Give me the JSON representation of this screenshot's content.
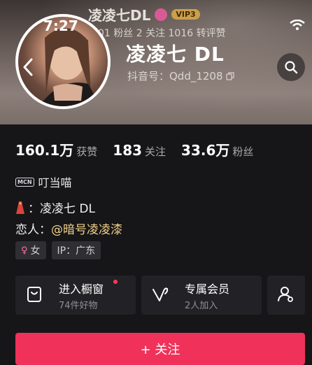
{
  "status_bar": {
    "time": "7:27",
    "wifi_icon": "wifi-icon"
  },
  "header_ghost": {
    "name": "凌凌七DL",
    "vip_label": "VIP3",
    "stats_text": "01 粉丝   2 关注   1016 转评赞"
  },
  "profile": {
    "display_name": "凌凌七 DL",
    "account_id": "抖音号：Qdd_1208",
    "avatar_icon": "avatar",
    "back_icon": "chevron-left-icon",
    "search_icon": "search-icon"
  },
  "stats": [
    {
      "value": "160.1万",
      "label": "获赞"
    },
    {
      "value": "183",
      "label": "关注"
    },
    {
      "value": "33.6万",
      "label": "粉丝"
    }
  ],
  "mcn": {
    "badge": "MCN",
    "name": "叮当喵"
  },
  "bio": {
    "line1": "：凌凌七 DL",
    "line2_prefix": "恋人：",
    "line2_mention": "@暗号凌凌漆"
  },
  "tags": [
    {
      "icon": "female-icon",
      "label": "女"
    },
    {
      "label": "IP：广东"
    }
  ],
  "cards": [
    {
      "title": "进入橱窗",
      "subtitle": "74件好物",
      "icon": "shop-window-icon"
    },
    {
      "title": "专属会员",
      "subtitle": "2人加入",
      "icon": "heart-v-icon"
    },
    {
      "icon": "add-friend-icon"
    }
  ],
  "follow_button": {
    "label": "+ 关注"
  },
  "colors": {
    "accent": "#f0325a",
    "mention": "#f1d089",
    "background": "#161618"
  }
}
